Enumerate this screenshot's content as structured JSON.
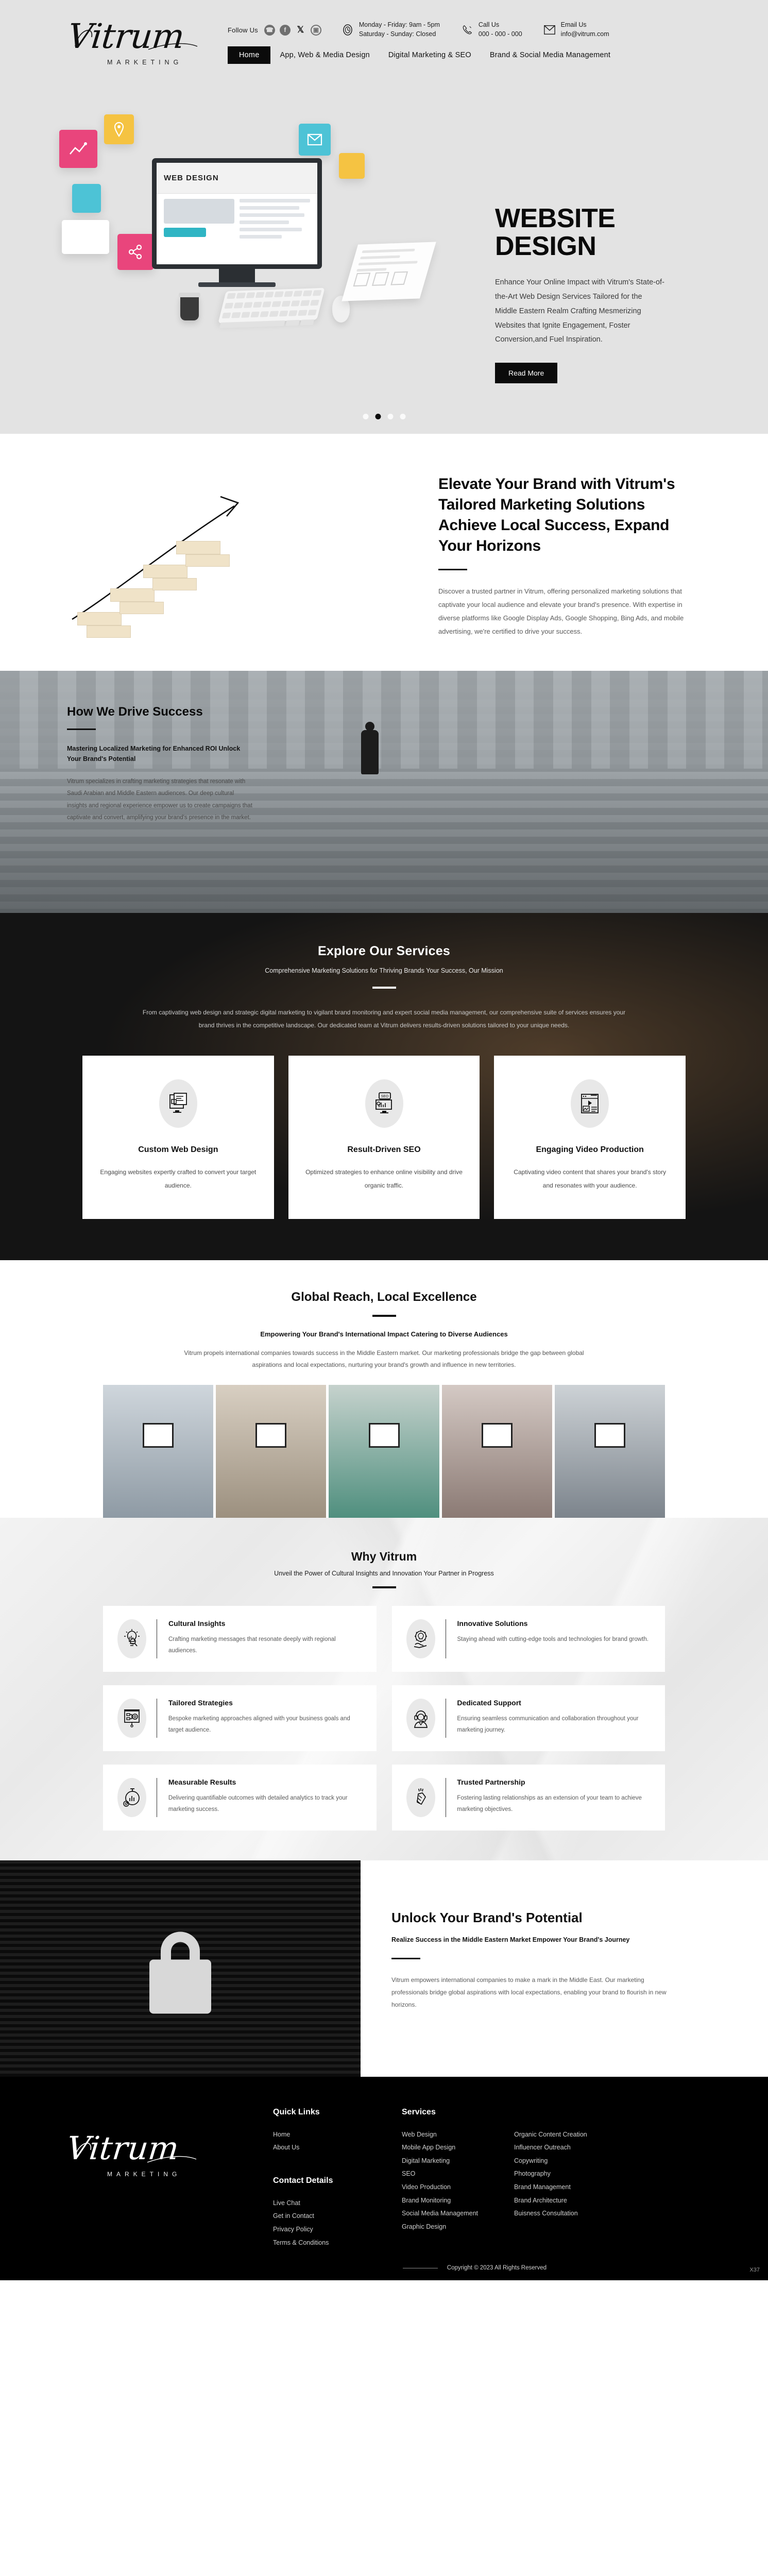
{
  "brand": {
    "name": "Vitrum",
    "tagline": "MARKETING"
  },
  "topbar": {
    "follow_label": "Follow Us",
    "social": [
      {
        "name": "whatsapp-icon",
        "glyph": "✆"
      },
      {
        "name": "facebook-icon",
        "glyph": "f"
      },
      {
        "name": "x-twitter-icon",
        "glyph": "✕"
      },
      {
        "name": "instagram-icon",
        "glyph": "▢"
      }
    ],
    "hours": {
      "icon": "clock-icon",
      "line1": "Monday - Friday: 9am - 5pm",
      "line2": "Saturday - Sunday: Closed"
    },
    "call": {
      "icon": "phone-icon",
      "label": "Call Us",
      "value": "000 - 000 - 000"
    },
    "email": {
      "icon": "envelope-icon",
      "label": "Email Us",
      "value": "info@vitrum.com"
    }
  },
  "nav": {
    "items": [
      {
        "label": "Home",
        "active": true
      },
      {
        "label": "App, Web & Media Design",
        "active": false
      },
      {
        "label": "Digital Marketing & SEO",
        "active": false
      },
      {
        "label": "Brand & Social Media Management",
        "active": false
      }
    ]
  },
  "hero": {
    "title_line1": "WEBSITE",
    "title_line2": "DESIGN",
    "paragraph": "Enhance Your Online Impact with Vitrum's State-of-the-Art Web Design Services Tailored for the Middle Eastern Realm Crafting Mesmerizing Websites that Ignite Engagement, Foster Conversion,and Fuel Inspiration.",
    "cta": "Read More",
    "screen_label": "WEB DESIGN",
    "dots_total": 4,
    "dot_active_index": 1
  },
  "elevate": {
    "heading": "Elevate Your Brand with Vitrum's Tailored Marketing Solutions Achieve Local Success, Expand Your Horizons",
    "paragraph": "Discover a trusted partner in Vitrum, offering personalized marketing solutions that captivate your local audience and elevate your brand's presence. With expertise in diverse platforms like Google Display Ads, Google Shopping, Bing Ads, and mobile advertising, we're certified to drive your success."
  },
  "drive": {
    "heading": "How We Drive Success",
    "subheading": "Mastering Localized Marketing for Enhanced ROI Unlock Your Brand's Potential",
    "paragraph": "Vitrum specializes in crafting marketing strategies that resonate with Saudi Arabian and Middle Eastern audiences. Our deep cultural insights and regional experience empower us to create campaigns that captivate and convert, amplifying your brand's presence in the market."
  },
  "services": {
    "heading": "Explore Our Services",
    "subheading": "Comprehensive Marketing Solutions for Thriving Brands Your Success, Our Mission",
    "paragraph": "From captivating web design and strategic digital marketing to vigilant brand monitoring and expert social media management, our comprehensive suite of services ensures your brand thrives in the competitive landscape. Our dedicated team at Vitrum delivers results-driven solutions tailored to your unique needs.",
    "cards": [
      {
        "icon": "web-design-monitor-icon",
        "title": "Custom Web Design",
        "text": "Engaging websites expertly crafted to convert your target audience."
      },
      {
        "icon": "seo-monitor-icon",
        "title": "Result-Driven SEO",
        "text": "Optimized strategies to enhance online visibility and drive organic traffic."
      },
      {
        "icon": "video-player-icon",
        "title": "Engaging Video Production",
        "text": "Captivating video content that shares your brand's story and resonates with your audience."
      }
    ]
  },
  "global": {
    "heading": "Global Reach, Local Excellence",
    "subheading": "Empowering Your Brand's International Impact Catering to Diverse Audiences",
    "paragraph": "Vitrum propels international companies towards success in the Middle Eastern market. Our marketing professionals bridge the gap between global aspirations and local expectations, nurturing your brand's growth and influence in new territories."
  },
  "why": {
    "heading": "Why Vitrum",
    "subheading": "Unveil the Power of Cultural Insights and Innovation Your Partner in Progress",
    "cards": [
      {
        "icon": "lightbulb-magnifier-icon",
        "title": "Cultural Insights",
        "text": "Crafting marketing messages that resonate deeply with regional audiences."
      },
      {
        "icon": "gear-lightbulb-hand-icon",
        "title": "Innovative Solutions",
        "text": "Staying ahead with cutting-edge tools and technologies for brand growth."
      },
      {
        "icon": "presentation-gear-icon",
        "title": "Tailored Strategies",
        "text": "Bespoke marketing approaches aligned with your business goals and target audience."
      },
      {
        "icon": "headset-agent-icon",
        "title": "Dedicated Support",
        "text": "Ensuring seamless communication and collaboration throughout your marketing journey."
      },
      {
        "icon": "stopwatch-chart-icon",
        "title": "Measurable Results",
        "text": "Delivering quantifiable outcomes with detailed analytics to track your marketing success."
      },
      {
        "icon": "handshake-icon",
        "title": "Trusted Partnership",
        "text": "Fostering lasting relationships as an extension of your team to achieve marketing objectives."
      }
    ]
  },
  "unlock": {
    "heading": "Unlock Your Brand's Potential",
    "subheading": "Realize Success in the Middle Eastern Market Empower Your Brand's Journey",
    "paragraph": "Vitrum empowers international companies to make a mark in the Middle East. Our marketing professionals bridge global aspirations with local expectations, enabling your brand to flourish in new horizons."
  },
  "footer": {
    "quick_links_head": "Quick Links",
    "quick_links": [
      "Home",
      "About Us"
    ],
    "contact_head": "Contact Details",
    "contact_links": [
      "Live Chat",
      "Get in Contact",
      "Privacy Policy",
      "Terms & Conditions"
    ],
    "services_head": "Services",
    "services_col1": [
      "Web Design",
      "Mobile App Design",
      "Digital Marketing",
      "SEO",
      "Video Production",
      "Brand Monitoring",
      "Social Media Management",
      "Graphic Design"
    ],
    "services_col2": [
      "Organic Content Creation",
      "Influencer Outreach",
      "Copywriting",
      "Photography",
      "Brand Management",
      "Brand Architecture",
      "Buisness Consultation"
    ],
    "copyright": "Copyright © 2023 All Rights Reserved",
    "build_tag": "X37"
  },
  "colors": {
    "accent": "#000000",
    "page_bg": "#ffffff",
    "topbar_bg": "#e3e3e3",
    "dark": "#111111"
  }
}
